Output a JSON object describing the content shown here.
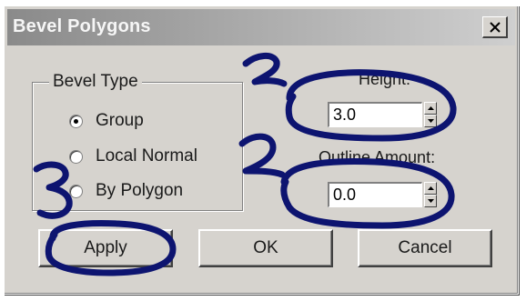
{
  "window": {
    "title": "Bevel Polygons",
    "close_glyph": "✕"
  },
  "bevel_type": {
    "legend": "Bevel Type",
    "options": [
      {
        "label": "Group",
        "checked": true
      },
      {
        "label": "Local Normal",
        "checked": false
      },
      {
        "label": "By Polygon",
        "checked": false
      }
    ]
  },
  "height": {
    "label": "Height:",
    "value": "3.0"
  },
  "outline_amount": {
    "label": "Outline Amount:",
    "value": "0.0"
  },
  "buttons": {
    "apply": "Apply",
    "ok": "OK",
    "cancel": "Cancel"
  },
  "annotations": {
    "marks": [
      "1",
      "2",
      "3"
    ],
    "ink_color": "#0d1470"
  },
  "colors": {
    "dialog_face": "#d6d3ce",
    "titlebar_gradient_start": "#8a8a8a",
    "titlebar_gradient_end": "#cfcfcf"
  }
}
